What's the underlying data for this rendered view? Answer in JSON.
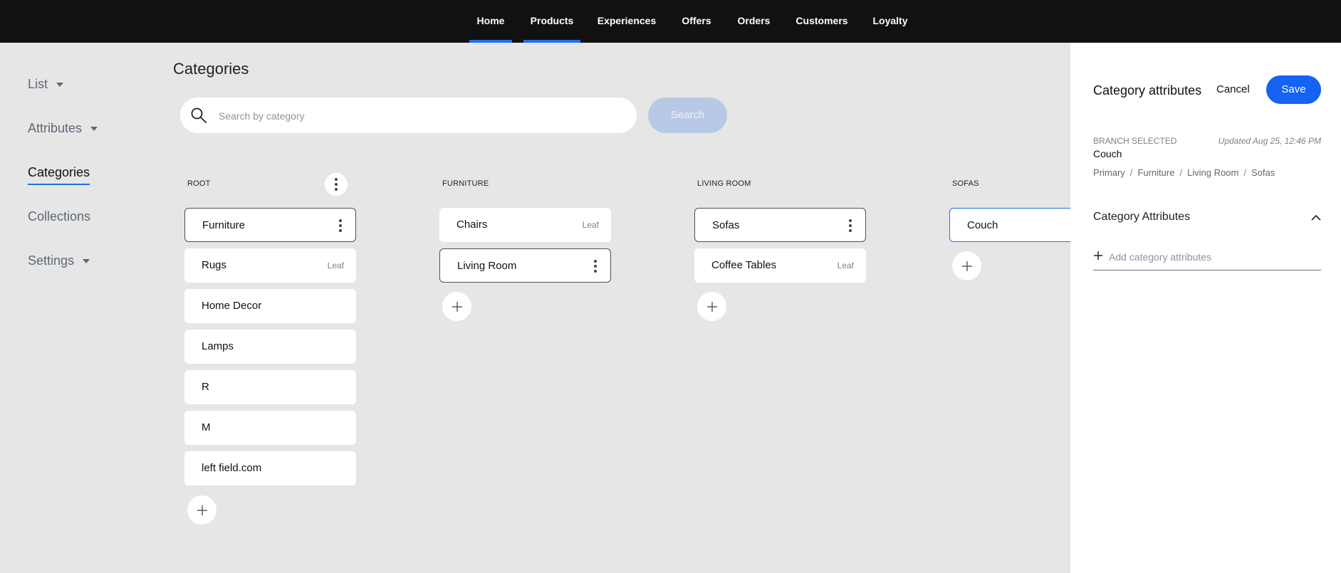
{
  "nav": {
    "items": [
      {
        "label": "Home",
        "active": true
      },
      {
        "label": "Products",
        "active": true
      },
      {
        "label": "Experiences",
        "active": false
      },
      {
        "label": "Offers",
        "active": false
      },
      {
        "label": "Orders",
        "active": false
      },
      {
        "label": "Customers",
        "active": false
      },
      {
        "label": "Loyalty",
        "active": false
      }
    ]
  },
  "sidebar": {
    "items": [
      {
        "label": "List",
        "has_caret": true
      },
      {
        "label": "Attributes",
        "has_caret": true
      },
      {
        "label": "Categories",
        "active": true
      },
      {
        "label": "Collections"
      },
      {
        "label": "Settings",
        "has_caret": true
      }
    ]
  },
  "main": {
    "title": "Categories",
    "search": {
      "placeholder": "Search by category",
      "value": "",
      "button_label": "Search"
    },
    "columns": [
      {
        "header": "ROOT",
        "items": [
          {
            "label": "Furniture",
            "selected": true
          },
          {
            "label": "Rugs",
            "badge": "Leaf"
          },
          {
            "label": "Home Decor"
          },
          {
            "label": "Lamps"
          },
          {
            "label": "R"
          },
          {
            "label": "M"
          },
          {
            "label": "left field.com"
          }
        ]
      },
      {
        "header": "FURNITURE",
        "items": [
          {
            "label": "Chairs",
            "badge": "Leaf"
          },
          {
            "label": "Living Room",
            "selected": true
          }
        ]
      },
      {
        "header": "LIVING ROOM",
        "items": [
          {
            "label": "Sofas",
            "selected": true
          },
          {
            "label": "Coffee Tables",
            "badge": "Leaf"
          }
        ]
      },
      {
        "header": "SOFAS",
        "items": [
          {
            "label": "Couch",
            "selected": true
          }
        ]
      }
    ]
  },
  "panel": {
    "title": "Category attributes",
    "cancel_label": "Cancel",
    "save_label": "Save",
    "branch_label": "BRANCH SELECTED",
    "branch_value": "Couch",
    "updated": "Updated Aug 25, 12:46 PM",
    "breadcrumb": [
      "Primary",
      "Furniture",
      "Living Room",
      "Sofas"
    ],
    "breadcrumb_separator": "/",
    "section_title": "Category Attributes",
    "add_attributes_label": "Add category attributes"
  },
  "colors": {
    "accent": "#1f6df2",
    "nav_bg": "#111111",
    "page_bg": "#e6e6e6",
    "disabled_button": "#b8c9e6"
  }
}
